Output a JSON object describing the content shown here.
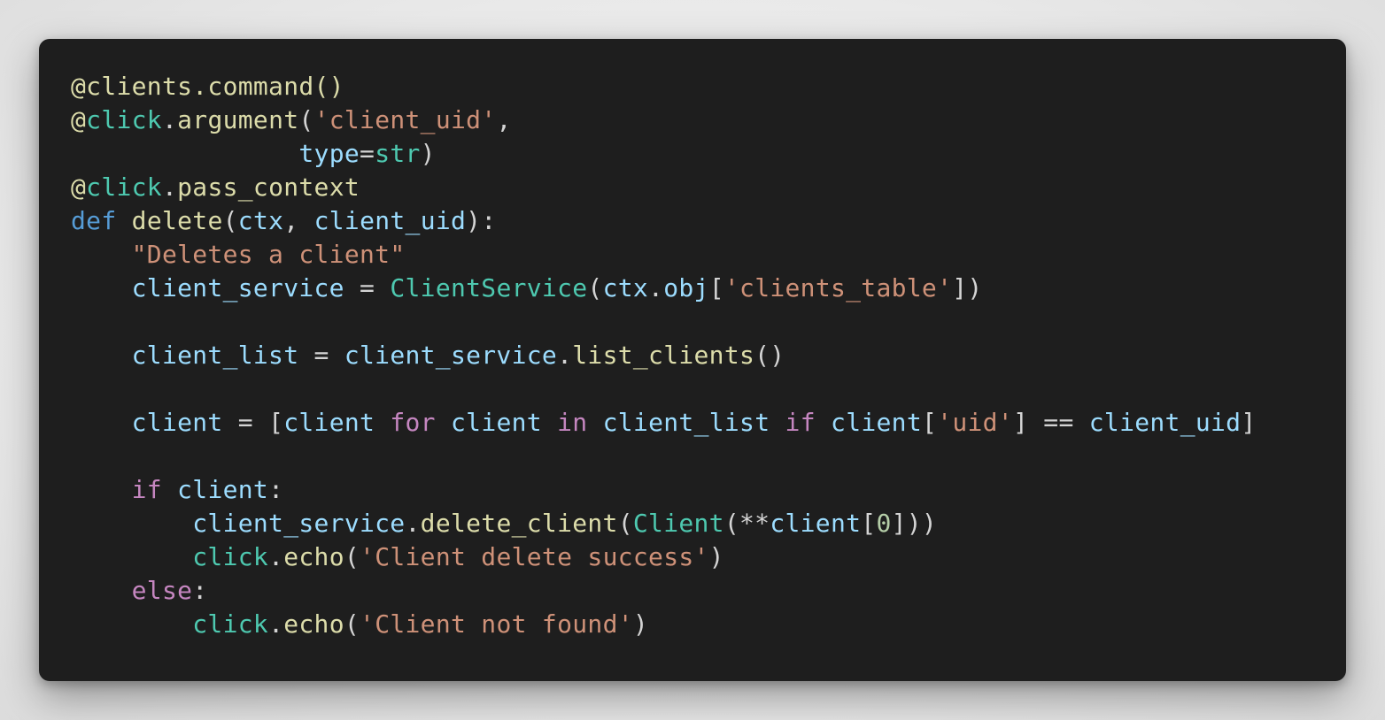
{
  "colors": {
    "background": "#1e1e1e",
    "page": "#ececec",
    "decorator": "#dcdcaa",
    "module": "#4ec9b0",
    "function": "#dcdcaa",
    "string": "#ce9178",
    "variable": "#9cdcfe",
    "keyword": "#569cd6",
    "control": "#c586c0",
    "number": "#b5cea8",
    "punctuation": "#d4d4d4"
  },
  "code": {
    "language": "python",
    "lines": [
      [
        {
          "t": "@clients.command()",
          "k": "deco"
        }
      ],
      [
        {
          "t": "@",
          "k": "deco"
        },
        {
          "t": "click",
          "k": "module"
        },
        {
          "t": ".",
          "k": "punct"
        },
        {
          "t": "argument",
          "k": "func"
        },
        {
          "t": "(",
          "k": "punct"
        },
        {
          "t": "'client_uid'",
          "k": "str"
        },
        {
          "t": ",",
          "k": "punct"
        }
      ],
      [
        {
          "t": "               ",
          "k": "plain"
        },
        {
          "t": "type",
          "k": "param"
        },
        {
          "t": "=",
          "k": "op"
        },
        {
          "t": "str",
          "k": "builtin"
        },
        {
          "t": ")",
          "k": "punct"
        }
      ],
      [
        {
          "t": "@",
          "k": "deco"
        },
        {
          "t": "click",
          "k": "module"
        },
        {
          "t": ".",
          "k": "punct"
        },
        {
          "t": "pass_context",
          "k": "func"
        }
      ],
      [
        {
          "t": "def",
          "k": "keyword"
        },
        {
          "t": " ",
          "k": "plain"
        },
        {
          "t": "delete",
          "k": "func"
        },
        {
          "t": "(",
          "k": "punct"
        },
        {
          "t": "ctx",
          "k": "param"
        },
        {
          "t": ", ",
          "k": "punct"
        },
        {
          "t": "client_uid",
          "k": "param"
        },
        {
          "t": "):",
          "k": "punct"
        }
      ],
      [
        {
          "t": "    ",
          "k": "plain"
        },
        {
          "t": "\"Deletes a client\"",
          "k": "str"
        }
      ],
      [
        {
          "t": "    ",
          "k": "plain"
        },
        {
          "t": "client_service",
          "k": "var"
        },
        {
          "t": " = ",
          "k": "op"
        },
        {
          "t": "ClientService",
          "k": "class"
        },
        {
          "t": "(",
          "k": "punct"
        },
        {
          "t": "ctx",
          "k": "var"
        },
        {
          "t": ".",
          "k": "punct"
        },
        {
          "t": "obj",
          "k": "var"
        },
        {
          "t": "[",
          "k": "punct"
        },
        {
          "t": "'clients_table'",
          "k": "str"
        },
        {
          "t": "])",
          "k": "punct"
        }
      ],
      [],
      [
        {
          "t": "    ",
          "k": "plain"
        },
        {
          "t": "client_list",
          "k": "var"
        },
        {
          "t": " = ",
          "k": "op"
        },
        {
          "t": "client_service",
          "k": "var"
        },
        {
          "t": ".",
          "k": "punct"
        },
        {
          "t": "list_clients",
          "k": "func"
        },
        {
          "t": "()",
          "k": "punct"
        }
      ],
      [],
      [
        {
          "t": "    ",
          "k": "plain"
        },
        {
          "t": "client",
          "k": "var"
        },
        {
          "t": " = [",
          "k": "op"
        },
        {
          "t": "client",
          "k": "var"
        },
        {
          "t": " ",
          "k": "plain"
        },
        {
          "t": "for",
          "k": "control"
        },
        {
          "t": " ",
          "k": "plain"
        },
        {
          "t": "client",
          "k": "var"
        },
        {
          "t": " ",
          "k": "plain"
        },
        {
          "t": "in",
          "k": "control"
        },
        {
          "t": " ",
          "k": "plain"
        },
        {
          "t": "client_list",
          "k": "var"
        },
        {
          "t": " ",
          "k": "plain"
        },
        {
          "t": "if",
          "k": "control"
        },
        {
          "t": " ",
          "k": "plain"
        },
        {
          "t": "client",
          "k": "var"
        },
        {
          "t": "[",
          "k": "punct"
        },
        {
          "t": "'uid'",
          "k": "str"
        },
        {
          "t": "] == ",
          "k": "op"
        },
        {
          "t": "client_uid",
          "k": "var"
        },
        {
          "t": "]",
          "k": "punct"
        }
      ],
      [],
      [
        {
          "t": "    ",
          "k": "plain"
        },
        {
          "t": "if",
          "k": "control"
        },
        {
          "t": " ",
          "k": "plain"
        },
        {
          "t": "client",
          "k": "var"
        },
        {
          "t": ":",
          "k": "punct"
        }
      ],
      [
        {
          "t": "        ",
          "k": "plain"
        },
        {
          "t": "client_service",
          "k": "var"
        },
        {
          "t": ".",
          "k": "punct"
        },
        {
          "t": "delete_client",
          "k": "func"
        },
        {
          "t": "(",
          "k": "punct"
        },
        {
          "t": "Client",
          "k": "class"
        },
        {
          "t": "(**",
          "k": "punct"
        },
        {
          "t": "client",
          "k": "var"
        },
        {
          "t": "[",
          "k": "punct"
        },
        {
          "t": "0",
          "k": "num"
        },
        {
          "t": "]))",
          "k": "punct"
        }
      ],
      [
        {
          "t": "        ",
          "k": "plain"
        },
        {
          "t": "click",
          "k": "module"
        },
        {
          "t": ".",
          "k": "punct"
        },
        {
          "t": "echo",
          "k": "func"
        },
        {
          "t": "(",
          "k": "punct"
        },
        {
          "t": "'Client delete success'",
          "k": "str"
        },
        {
          "t": ")",
          "k": "punct"
        }
      ],
      [
        {
          "t": "    ",
          "k": "plain"
        },
        {
          "t": "else",
          "k": "control"
        },
        {
          "t": ":",
          "k": "punct"
        }
      ],
      [
        {
          "t": "        ",
          "k": "plain"
        },
        {
          "t": "click",
          "k": "module"
        },
        {
          "t": ".",
          "k": "punct"
        },
        {
          "t": "echo",
          "k": "func"
        },
        {
          "t": "(",
          "k": "punct"
        },
        {
          "t": "'Client not found'",
          "k": "str"
        },
        {
          "t": ")",
          "k": "punct"
        }
      ]
    ]
  }
}
